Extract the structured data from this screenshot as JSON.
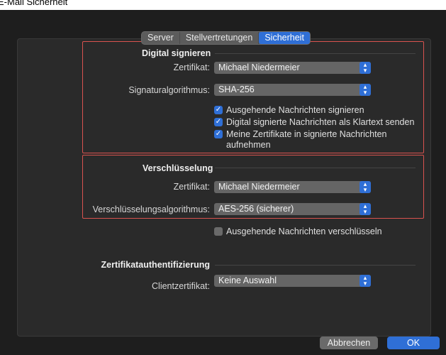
{
  "window": {
    "title": "E-Mail Sicherheit"
  },
  "tabs": [
    {
      "label": "Server"
    },
    {
      "label": "Stellvertretungen"
    },
    {
      "label": "Sicherheit"
    }
  ],
  "signing": {
    "title": "Digital signieren",
    "cert_label": "Zertifikat:",
    "cert_value": "Michael Niedermeier",
    "algo_label": "Signaturalgorithmus:",
    "algo_value": "SHA-256",
    "opt1": "Ausgehende Nachrichten signieren",
    "opt2": "Digital signierte Nachrichten als Klartext senden",
    "opt3_line1": "Meine Zertifikate in signierte Nachrichten",
    "opt3_line2": "aufnehmen"
  },
  "encryption": {
    "title": "Verschlüsselung",
    "cert_label": "Zertifikat:",
    "cert_value": "Michael Niedermeier",
    "algo_label": "Verschlüsselungsalgorithmus:",
    "algo_value": "AES-256 (sicherer)",
    "opt_encrypt": "Ausgehende Nachrichten verschlüsseln"
  },
  "auth": {
    "title": "Zertifikatauthentifizierung",
    "client_label": "Clientzertifikat:",
    "client_value": "Keine Auswahl"
  },
  "buttons": {
    "cancel": "Abbrechen",
    "ok": "OK"
  },
  "colors": {
    "accent": "#2f6fd6",
    "highlight_border": "#d9534f"
  }
}
